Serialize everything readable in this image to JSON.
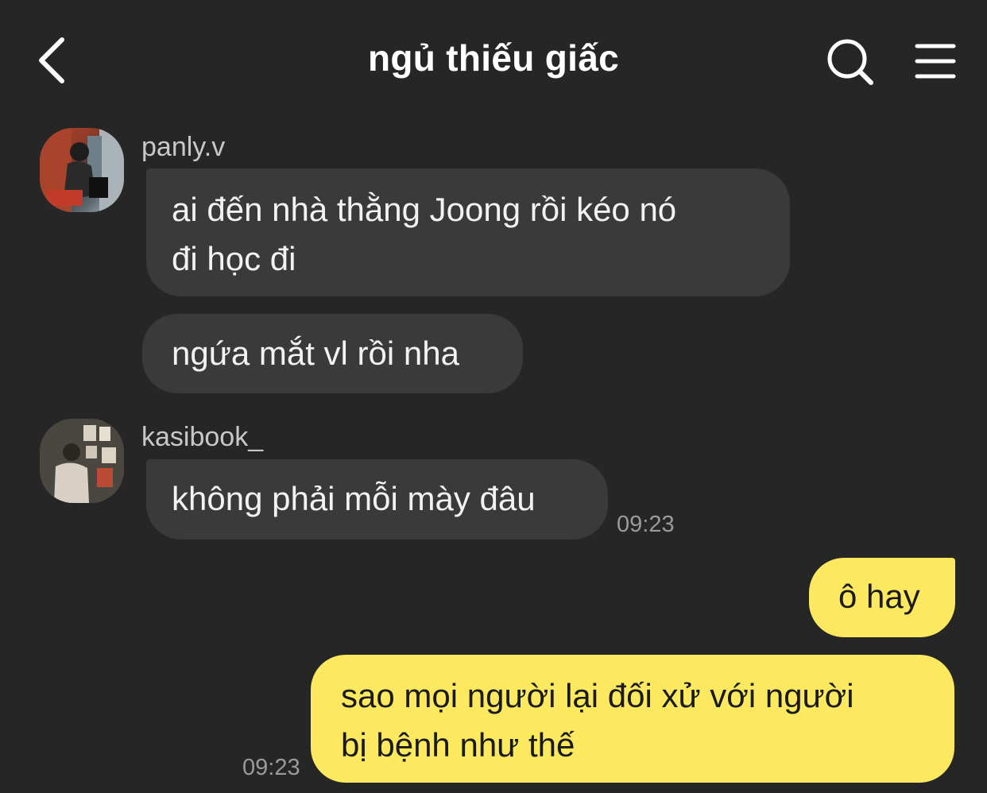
{
  "header": {
    "title": "ngủ thiếu giấc",
    "icons": {
      "back": "chevron-left-icon",
      "search": "search-icon",
      "menu": "menu-icon"
    }
  },
  "messages": [
    {
      "sender": "panly.v",
      "lines": [
        "ai đến nhà thằng Joong rồi kéo nó",
        "đi học đi"
      ]
    },
    {
      "sender": "panly.v",
      "lines": [
        "ngứa mắt vl rồi nha"
      ]
    },
    {
      "sender": "kasibook_",
      "lines": [
        "không phải mỗi mày đâu"
      ],
      "time": "09:23"
    },
    {
      "sender": "me",
      "lines": [
        "ô hay"
      ]
    },
    {
      "sender": "me",
      "lines": [
        "sao mọi người lại đối xử với người",
        "bị bệnh như thế"
      ],
      "time": "09:23"
    }
  ],
  "colors": {
    "background": "#262626",
    "incoming_bubble": "#3a3a3a",
    "outgoing_bubble": "#fde95f",
    "timestamp": "#9a9a9a",
    "sender_name": "#c8c8c8"
  }
}
